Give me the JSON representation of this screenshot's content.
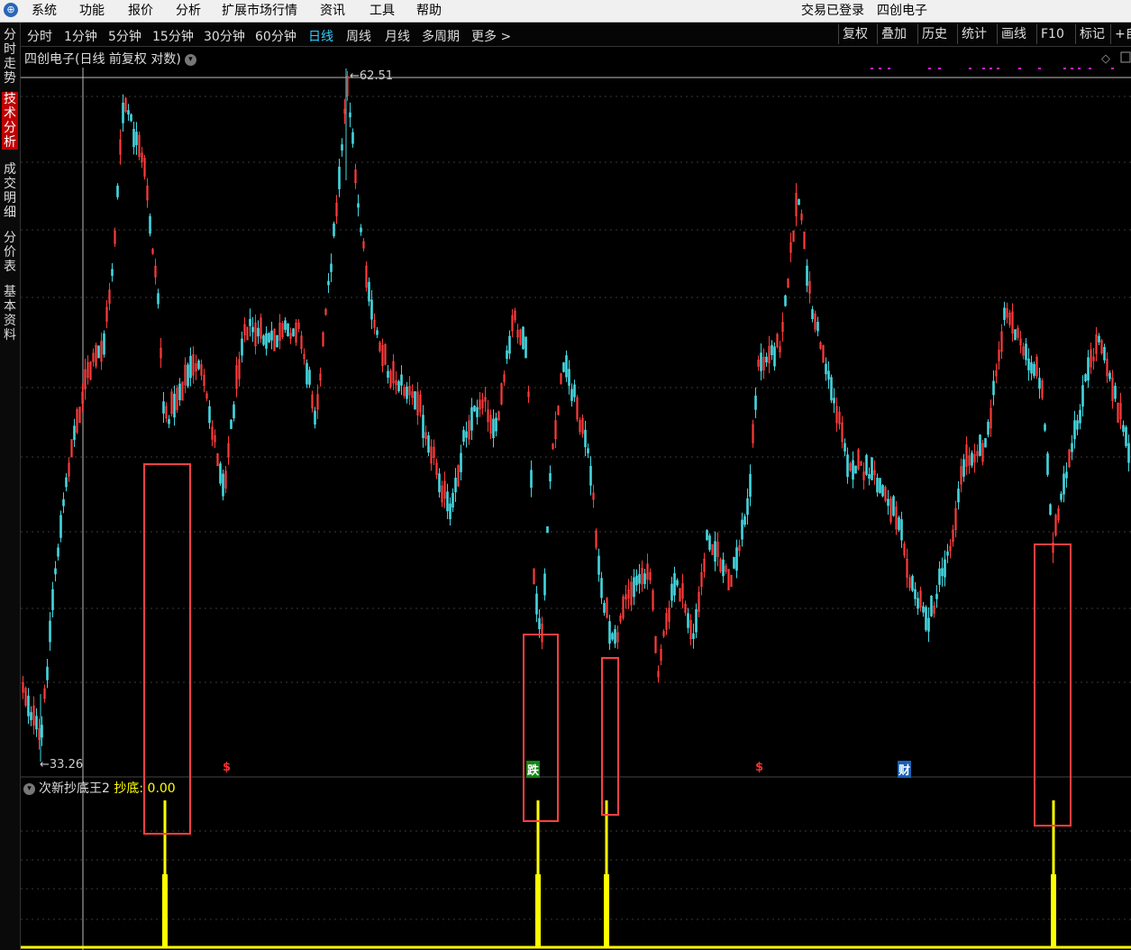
{
  "menu": {
    "items": [
      "系统",
      "功能",
      "报价",
      "分析",
      "扩展市场行情",
      "资讯",
      "工具",
      "帮助"
    ],
    "login_status": "交易已登录",
    "stock_name": "四创电子"
  },
  "left_tabs": [
    {
      "label": "分时走势",
      "active": false
    },
    {
      "label": "技术分析",
      "active": true
    },
    {
      "label": "成交明细",
      "active": false
    },
    {
      "label": "分价表",
      "active": false
    },
    {
      "label": "基本资料",
      "active": false
    }
  ],
  "periods": {
    "items": [
      "分时",
      "1分钟",
      "5分钟",
      "15分钟",
      "30分钟",
      "60分钟",
      "日线",
      "周线",
      "月线",
      "多周期",
      "更多 >"
    ],
    "active": "日线"
  },
  "toolbar": [
    "复权",
    "叠加",
    "历史",
    "统计",
    "画线",
    "F10",
    "标记",
    "+自"
  ],
  "chart": {
    "title": "四创电子(日线 前复权 对数)",
    "high_label": "62.51",
    "low_label": "33.26"
  },
  "indicator": {
    "name": "次新抄底王2",
    "field": "抄底",
    "value": "0.00",
    "color": "#ffff00"
  },
  "markers": [
    {
      "text": "$",
      "color": "#ff3030"
    },
    {
      "text": "跌",
      "color": "#ffffff",
      "bg": "#118811"
    },
    {
      "text": "$",
      "color": "#ff3030"
    },
    {
      "text": "财",
      "color": "#ffffff",
      "bg": "#1a5fb4"
    }
  ],
  "colors": {
    "up": "#ff3b3b",
    "down": "#44d7e0",
    "highlight_box": "#ff4040",
    "signal": "#ffff00"
  },
  "chart_data": {
    "type": "candlestick",
    "title": "四创电子(日线 前复权 对数)",
    "price_high": 62.51,
    "price_low": 33.26,
    "signal_series": {
      "name": "抄底",
      "spike_count": 4,
      "latest_value": 0.0
    }
  }
}
